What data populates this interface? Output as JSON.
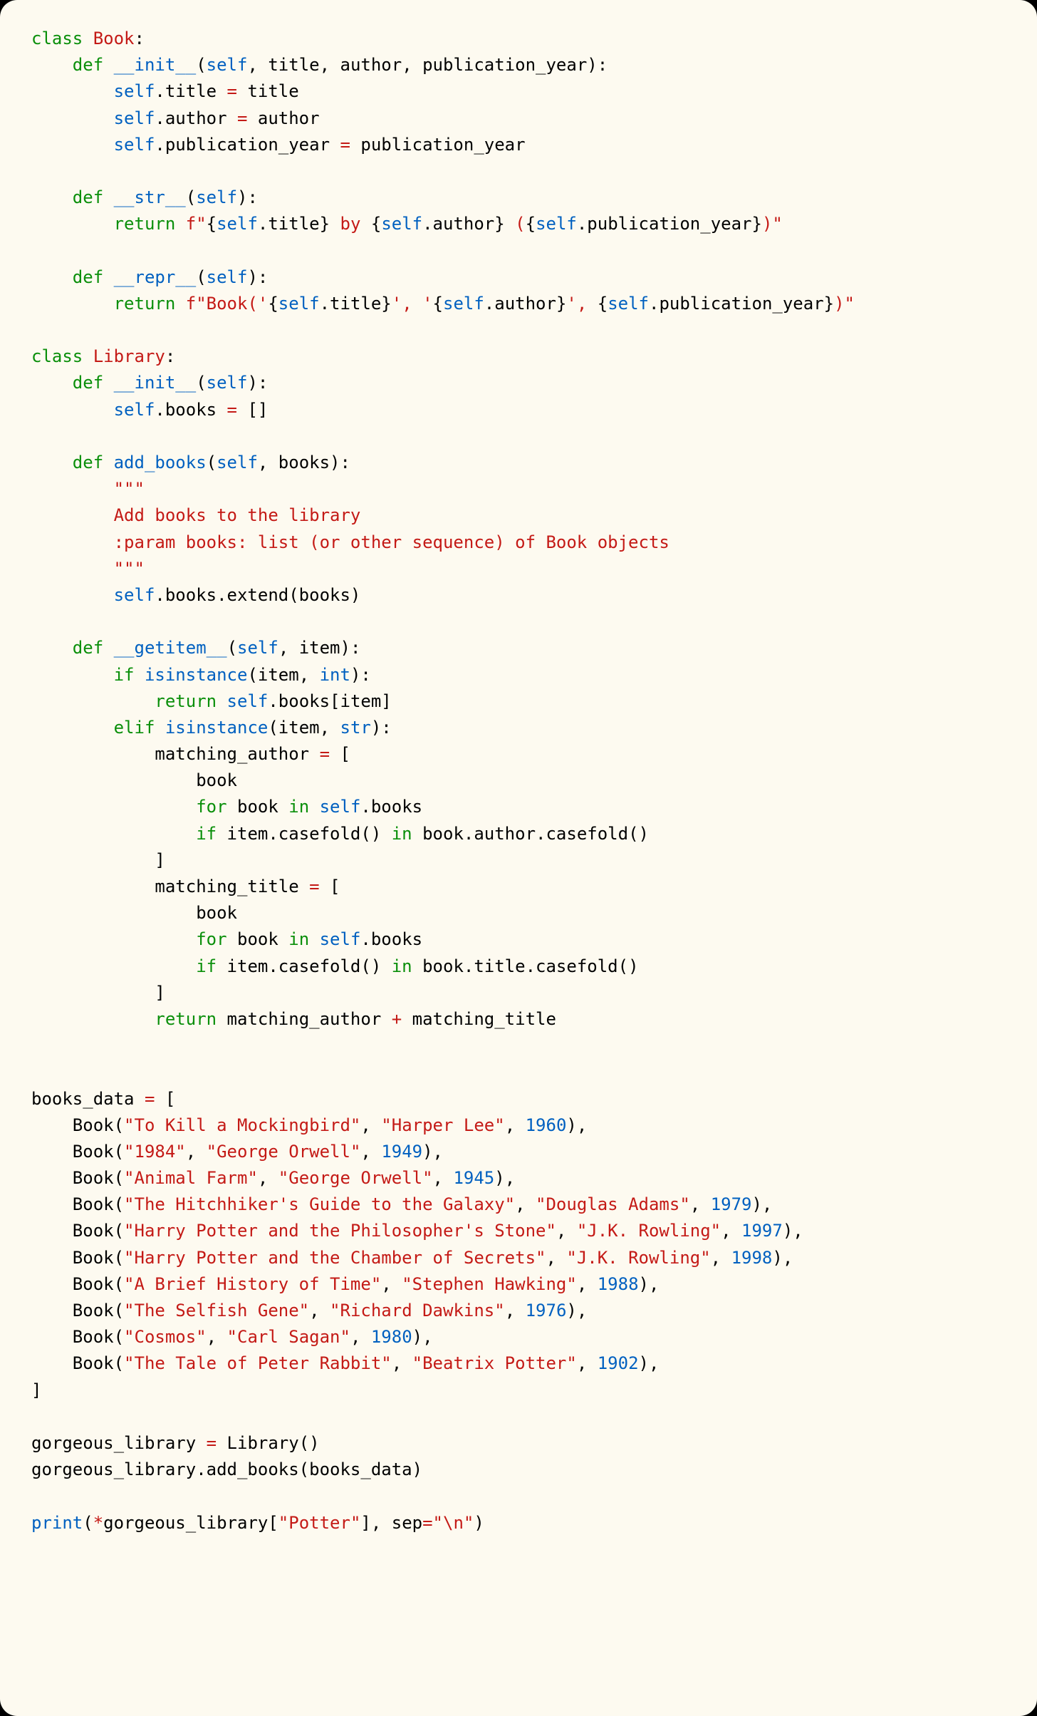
{
  "code": {
    "lines": [
      [
        [
          "kw",
          "class"
        ],
        [
          "plain",
          " "
        ],
        [
          "cls",
          "Book"
        ],
        [
          "plain",
          ":"
        ]
      ],
      [
        [
          "plain",
          "    "
        ],
        [
          "kw",
          "def"
        ],
        [
          "plain",
          " "
        ],
        [
          "dunder",
          "__init__"
        ],
        [
          "plain",
          "("
        ],
        [
          "self",
          "self"
        ],
        [
          "plain",
          ", title, author, publication_year):"
        ]
      ],
      [
        [
          "plain",
          "        "
        ],
        [
          "self",
          "self"
        ],
        [
          "plain",
          ".title "
        ],
        [
          "op",
          "="
        ],
        [
          "plain",
          " title"
        ]
      ],
      [
        [
          "plain",
          "        "
        ],
        [
          "self",
          "self"
        ],
        [
          "plain",
          ".author "
        ],
        [
          "op",
          "="
        ],
        [
          "plain",
          " author"
        ]
      ],
      [
        [
          "plain",
          "        "
        ],
        [
          "self",
          "self"
        ],
        [
          "plain",
          ".publication_year "
        ],
        [
          "op",
          "="
        ],
        [
          "plain",
          " publication_year"
        ]
      ],
      [],
      [
        [
          "plain",
          "    "
        ],
        [
          "kw",
          "def"
        ],
        [
          "plain",
          " "
        ],
        [
          "dunder",
          "__str__"
        ],
        [
          "plain",
          "("
        ],
        [
          "self",
          "self"
        ],
        [
          "plain",
          "):"
        ]
      ],
      [
        [
          "plain",
          "        "
        ],
        [
          "kw",
          "return"
        ],
        [
          "plain",
          " "
        ],
        [
          "str",
          "f\""
        ],
        [
          "plain",
          "{"
        ],
        [
          "self",
          "self"
        ],
        [
          "plain",
          ".title} "
        ],
        [
          "str",
          "by"
        ],
        [
          "plain",
          " {"
        ],
        [
          "self",
          "self"
        ],
        [
          "plain",
          ".author} "
        ],
        [
          "str",
          "("
        ],
        [
          "plain",
          "{"
        ],
        [
          "self",
          "self"
        ],
        [
          "plain",
          ".publication_year}"
        ],
        [
          "str",
          ")\""
        ]
      ],
      [],
      [
        [
          "plain",
          "    "
        ],
        [
          "kw",
          "def"
        ],
        [
          "plain",
          " "
        ],
        [
          "dunder",
          "__repr__"
        ],
        [
          "plain",
          "("
        ],
        [
          "self",
          "self"
        ],
        [
          "plain",
          "):"
        ]
      ],
      [
        [
          "plain",
          "        "
        ],
        [
          "kw",
          "return"
        ],
        [
          "plain",
          " "
        ],
        [
          "str",
          "f\"Book('"
        ],
        [
          "plain",
          "{"
        ],
        [
          "self",
          "self"
        ],
        [
          "plain",
          ".title}"
        ],
        [
          "str",
          "', '"
        ],
        [
          "plain",
          "{"
        ],
        [
          "self",
          "self"
        ],
        [
          "plain",
          ".author}"
        ],
        [
          "str",
          "', "
        ],
        [
          "plain",
          "{"
        ],
        [
          "self",
          "self"
        ],
        [
          "plain",
          ".publication_year}"
        ],
        [
          "str",
          ")\""
        ]
      ],
      [],
      [
        [
          "kw",
          "class"
        ],
        [
          "plain",
          " "
        ],
        [
          "cls",
          "Library"
        ],
        [
          "plain",
          ":"
        ]
      ],
      [
        [
          "plain",
          "    "
        ],
        [
          "kw",
          "def"
        ],
        [
          "plain",
          " "
        ],
        [
          "dunder",
          "__init__"
        ],
        [
          "plain",
          "("
        ],
        [
          "self",
          "self"
        ],
        [
          "plain",
          "):"
        ]
      ],
      [
        [
          "plain",
          "        "
        ],
        [
          "self",
          "self"
        ],
        [
          "plain",
          ".books "
        ],
        [
          "op",
          "="
        ],
        [
          "plain",
          " []"
        ]
      ],
      [],
      [
        [
          "plain",
          "    "
        ],
        [
          "kw",
          "def"
        ],
        [
          "plain",
          " "
        ],
        [
          "fn",
          "add_books"
        ],
        [
          "plain",
          "("
        ],
        [
          "self",
          "self"
        ],
        [
          "plain",
          ", books):"
        ]
      ],
      [
        [
          "plain",
          "        "
        ],
        [
          "str",
          "\"\"\""
        ]
      ],
      [
        [
          "plain",
          "        "
        ],
        [
          "str",
          "Add books to the library"
        ]
      ],
      [
        [
          "plain",
          "        "
        ],
        [
          "str",
          ":param books: list (or other sequence) of Book objects"
        ]
      ],
      [
        [
          "plain",
          "        "
        ],
        [
          "str",
          "\"\"\""
        ]
      ],
      [
        [
          "plain",
          "        "
        ],
        [
          "self",
          "self"
        ],
        [
          "plain",
          ".books.extend(books)"
        ]
      ],
      [],
      [
        [
          "plain",
          "    "
        ],
        [
          "kw",
          "def"
        ],
        [
          "plain",
          " "
        ],
        [
          "dunder",
          "__getitem__"
        ],
        [
          "plain",
          "("
        ],
        [
          "self",
          "self"
        ],
        [
          "plain",
          ", item):"
        ]
      ],
      [
        [
          "plain",
          "        "
        ],
        [
          "kw",
          "if"
        ],
        [
          "plain",
          " "
        ],
        [
          "builtin",
          "isinstance"
        ],
        [
          "plain",
          "(item, "
        ],
        [
          "builtin",
          "int"
        ],
        [
          "plain",
          "):"
        ]
      ],
      [
        [
          "plain",
          "            "
        ],
        [
          "kw",
          "return"
        ],
        [
          "plain",
          " "
        ],
        [
          "self",
          "self"
        ],
        [
          "plain",
          ".books[item]"
        ]
      ],
      [
        [
          "plain",
          "        "
        ],
        [
          "kw",
          "elif"
        ],
        [
          "plain",
          " "
        ],
        [
          "builtin",
          "isinstance"
        ],
        [
          "plain",
          "(item, "
        ],
        [
          "builtin",
          "str"
        ],
        [
          "plain",
          "):"
        ]
      ],
      [
        [
          "plain",
          "            matching_author "
        ],
        [
          "op",
          "="
        ],
        [
          "plain",
          " ["
        ]
      ],
      [
        [
          "plain",
          "                book"
        ]
      ],
      [
        [
          "plain",
          "                "
        ],
        [
          "kw",
          "for"
        ],
        [
          "plain",
          " book "
        ],
        [
          "kw",
          "in"
        ],
        [
          "plain",
          " "
        ],
        [
          "self",
          "self"
        ],
        [
          "plain",
          ".books"
        ]
      ],
      [
        [
          "plain",
          "                "
        ],
        [
          "kw",
          "if"
        ],
        [
          "plain",
          " item.casefold() "
        ],
        [
          "kw",
          "in"
        ],
        [
          "plain",
          " book.author.casefold()"
        ]
      ],
      [
        [
          "plain",
          "            ]"
        ]
      ],
      [
        [
          "plain",
          "            matching_title "
        ],
        [
          "op",
          "="
        ],
        [
          "plain",
          " ["
        ]
      ],
      [
        [
          "plain",
          "                book"
        ]
      ],
      [
        [
          "plain",
          "                "
        ],
        [
          "kw",
          "for"
        ],
        [
          "plain",
          " book "
        ],
        [
          "kw",
          "in"
        ],
        [
          "plain",
          " "
        ],
        [
          "self",
          "self"
        ],
        [
          "plain",
          ".books"
        ]
      ],
      [
        [
          "plain",
          "                "
        ],
        [
          "kw",
          "if"
        ],
        [
          "plain",
          " item.casefold() "
        ],
        [
          "kw",
          "in"
        ],
        [
          "plain",
          " book.title.casefold()"
        ]
      ],
      [
        [
          "plain",
          "            ]"
        ]
      ],
      [
        [
          "plain",
          "            "
        ],
        [
          "kw",
          "return"
        ],
        [
          "plain",
          " matching_author "
        ],
        [
          "op",
          "+"
        ],
        [
          "plain",
          " matching_title"
        ]
      ],
      [],
      [],
      [
        [
          "plain",
          "books_data "
        ],
        [
          "op",
          "="
        ],
        [
          "plain",
          " ["
        ]
      ],
      [
        [
          "plain",
          "    Book("
        ],
        [
          "str",
          "\"To Kill a Mockingbird\""
        ],
        [
          "plain",
          ", "
        ],
        [
          "str",
          "\"Harper Lee\""
        ],
        [
          "plain",
          ", "
        ],
        [
          "num",
          "1960"
        ],
        [
          "plain",
          "),"
        ]
      ],
      [
        [
          "plain",
          "    Book("
        ],
        [
          "str",
          "\"1984\""
        ],
        [
          "plain",
          ", "
        ],
        [
          "str",
          "\"George Orwell\""
        ],
        [
          "plain",
          ", "
        ],
        [
          "num",
          "1949"
        ],
        [
          "plain",
          "),"
        ]
      ],
      [
        [
          "plain",
          "    Book("
        ],
        [
          "str",
          "\"Animal Farm\""
        ],
        [
          "plain",
          ", "
        ],
        [
          "str",
          "\"George Orwell\""
        ],
        [
          "plain",
          ", "
        ],
        [
          "num",
          "1945"
        ],
        [
          "plain",
          "),"
        ]
      ],
      [
        [
          "plain",
          "    Book("
        ],
        [
          "str",
          "\"The Hitchhiker's Guide to the Galaxy\""
        ],
        [
          "plain",
          ", "
        ],
        [
          "str",
          "\"Douglas Adams\""
        ],
        [
          "plain",
          ", "
        ],
        [
          "num",
          "1979"
        ],
        [
          "plain",
          "),"
        ]
      ],
      [
        [
          "plain",
          "    Book("
        ],
        [
          "str",
          "\"Harry Potter and the Philosopher's Stone\""
        ],
        [
          "plain",
          ", "
        ],
        [
          "str",
          "\"J.K. Rowling\""
        ],
        [
          "plain",
          ", "
        ],
        [
          "num",
          "1997"
        ],
        [
          "plain",
          "),"
        ]
      ],
      [
        [
          "plain",
          "    Book("
        ],
        [
          "str",
          "\"Harry Potter and the Chamber of Secrets\""
        ],
        [
          "plain",
          ", "
        ],
        [
          "str",
          "\"J.K. Rowling\""
        ],
        [
          "plain",
          ", "
        ],
        [
          "num",
          "1998"
        ],
        [
          "plain",
          "),"
        ]
      ],
      [
        [
          "plain",
          "    Book("
        ],
        [
          "str",
          "\"A Brief History of Time\""
        ],
        [
          "plain",
          ", "
        ],
        [
          "str",
          "\"Stephen Hawking\""
        ],
        [
          "plain",
          ", "
        ],
        [
          "num",
          "1988"
        ],
        [
          "plain",
          "),"
        ]
      ],
      [
        [
          "plain",
          "    Book("
        ],
        [
          "str",
          "\"The Selfish Gene\""
        ],
        [
          "plain",
          ", "
        ],
        [
          "str",
          "\"Richard Dawkins\""
        ],
        [
          "plain",
          ", "
        ],
        [
          "num",
          "1976"
        ],
        [
          "plain",
          "),"
        ]
      ],
      [
        [
          "plain",
          "    Book("
        ],
        [
          "str",
          "\"Cosmos\""
        ],
        [
          "plain",
          ", "
        ],
        [
          "str",
          "\"Carl Sagan\""
        ],
        [
          "plain",
          ", "
        ],
        [
          "num",
          "1980"
        ],
        [
          "plain",
          "),"
        ]
      ],
      [
        [
          "plain",
          "    Book("
        ],
        [
          "str",
          "\"The Tale of Peter Rabbit\""
        ],
        [
          "plain",
          ", "
        ],
        [
          "str",
          "\"Beatrix Potter\""
        ],
        [
          "plain",
          ", "
        ],
        [
          "num",
          "1902"
        ],
        [
          "plain",
          "),"
        ]
      ],
      [
        [
          "plain",
          "]"
        ]
      ],
      [],
      [
        [
          "plain",
          "gorgeous_library "
        ],
        [
          "op",
          "="
        ],
        [
          "plain",
          " Library()"
        ]
      ],
      [
        [
          "plain",
          "gorgeous_library.add_books(books_data)"
        ]
      ],
      [],
      [
        [
          "builtin",
          "print"
        ],
        [
          "plain",
          "("
        ],
        [
          "op",
          "*"
        ],
        [
          "plain",
          "gorgeous_library["
        ],
        [
          "str",
          "\"Potter\""
        ],
        [
          "plain",
          "], sep"
        ],
        [
          "op",
          "="
        ],
        [
          "str",
          "\"\\n\""
        ],
        [
          "plain",
          ")"
        ]
      ]
    ]
  },
  "book_data": [
    {
      "title": "To Kill a Mockingbird",
      "author": "Harper Lee",
      "year": 1960
    },
    {
      "title": "1984",
      "author": "George Orwell",
      "year": 1949
    },
    {
      "title": "Animal Farm",
      "author": "George Orwell",
      "year": 1945
    },
    {
      "title": "The Hitchhiker's Guide to the Galaxy",
      "author": "Douglas Adams",
      "year": 1979
    },
    {
      "title": "Harry Potter and the Philosopher's Stone",
      "author": "J.K. Rowling",
      "year": 1997
    },
    {
      "title": "Harry Potter and the Chamber of Secrets",
      "author": "J.K. Rowling",
      "year": 1998
    },
    {
      "title": "A Brief History of Time",
      "author": "Stephen Hawking",
      "year": 1988
    },
    {
      "title": "The Selfish Gene",
      "author": "Richard Dawkins",
      "year": 1976
    },
    {
      "title": "Cosmos",
      "author": "Carl Sagan",
      "year": 1980
    },
    {
      "title": "The Tale of Peter Rabbit",
      "author": "Beatrix Potter",
      "year": 1902
    }
  ],
  "query_string": "Potter",
  "colors": {
    "background": "#fdfaf0",
    "keyword": "#0a8f0a",
    "class_name": "#c41a16",
    "function_name": "#0060c0",
    "string": "#c41a16",
    "number": "#0060c0",
    "builtin": "#0060c0"
  }
}
